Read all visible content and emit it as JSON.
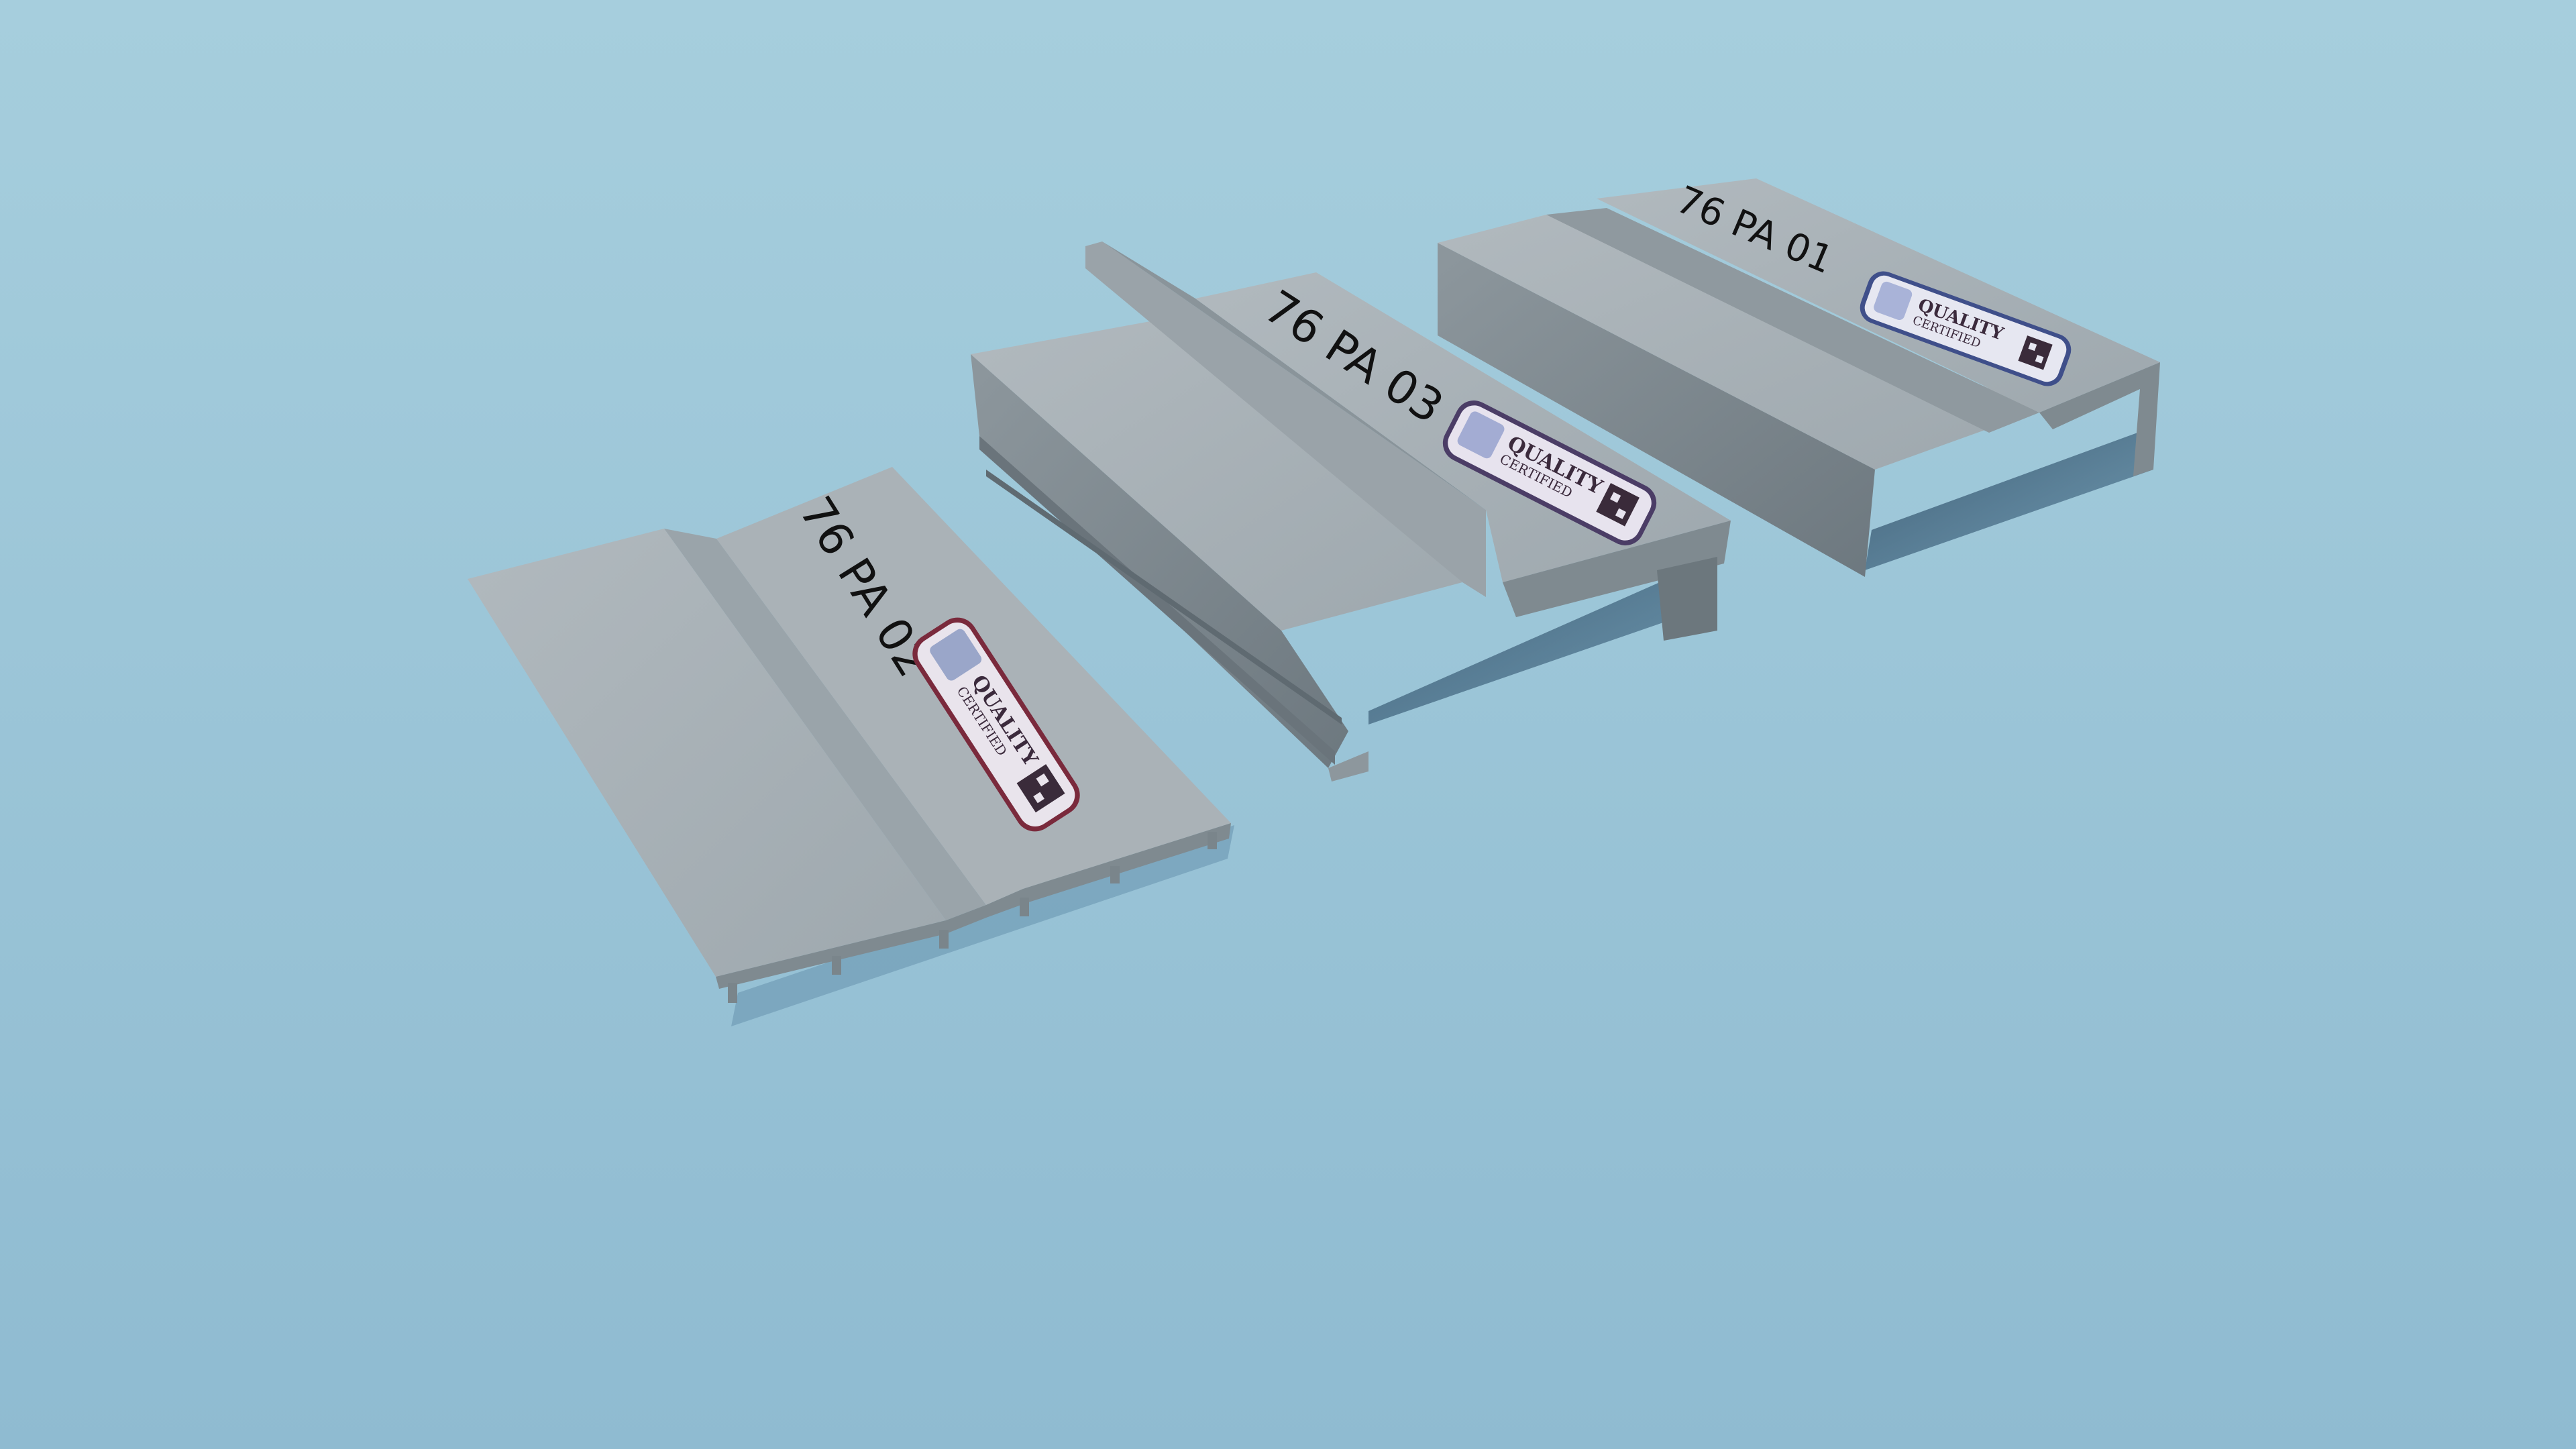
{
  "scene": {
    "background": "#93c0d4",
    "profile_color": "#a3adb3",
    "profiles": [
      {
        "code": "76 PA 02",
        "badge": {
          "title": "QUALITY",
          "subtitle": "CERTIFIED"
        },
        "badge_accent": "#7a2a3c"
      },
      {
        "code": "76 PA 03",
        "badge": {
          "title": "QUALITY",
          "subtitle": "CERTIFIED"
        },
        "badge_accent": "#4b3d66"
      },
      {
        "code": "76 PA 01",
        "badge": {
          "title": "QUALITY",
          "subtitle": "CERTIFIED"
        },
        "badge_accent": "#3f4f8a"
      }
    ]
  }
}
